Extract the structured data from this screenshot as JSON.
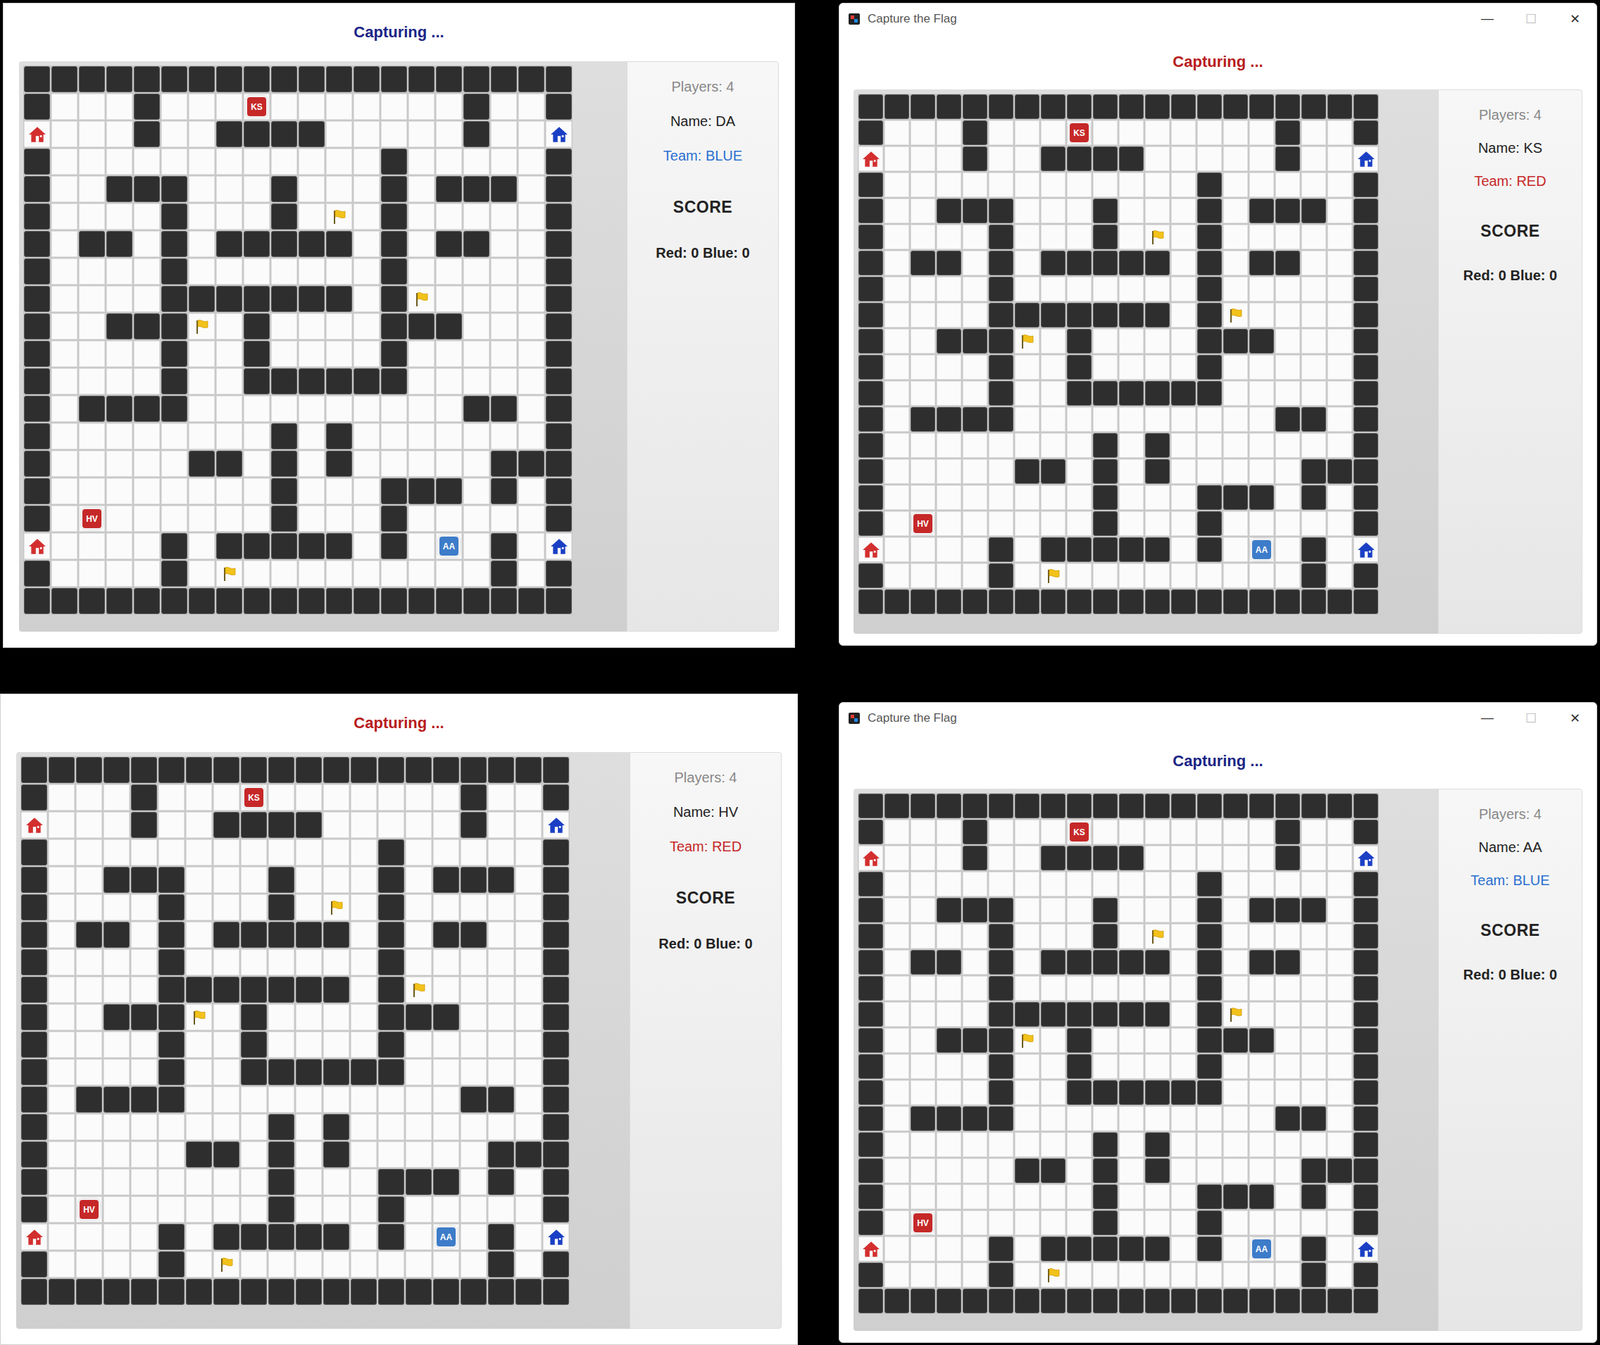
{
  "board": [
    "####################",
    "#...#...........#..#",
    "R...#..####.....#..B",
    "#............#.....#",
    "#..###...#...#.###.#",
    "#....#...#.F.#.....#",
    "#.##.#.#####.#.##..#",
    "#....#.......#.....#",
    "#....#######.#F....#",
    "#..###F.#....###...#",
    "#....#..#....#.....#",
    "#....#..######.....#",
    "#.####..........##.#",
    "#........#.#.......#",
    "#.....##.#.#.....###",
    "#........#...###.#.#",
    "#........#...#.....#",
    "R....#.#####.#...#.B",
    "#....#.F.........#.#",
    "####################"
  ],
  "home_colors": {
    "R": "#d32f2f",
    "B": "#1a3fc4"
  },
  "pieces": [
    {
      "label": "KS",
      "row": 1,
      "col": 8,
      "color": "#c62828"
    },
    {
      "label": "HV",
      "row": 16,
      "col": 2,
      "color": "#c62828"
    },
    {
      "label": "AA",
      "row": 17,
      "col": 15,
      "color": "#3d7cc9"
    }
  ],
  "windows": [
    {
      "title": "",
      "controls": [],
      "status": "Capturing ...",
      "status_color": "#1a2585",
      "players": "Players: 4",
      "name": "Name: DA",
      "team": "Team: BLUE",
      "team_color": "#2a6fd0",
      "score_heading": "SCORE",
      "score": "Red: 0 Blue: 0"
    },
    {
      "title": "Capture the Flag",
      "controls": [
        {
          "label": "—",
          "disabled": false
        },
        {
          "label": "☐",
          "disabled": true
        },
        {
          "label": "✕",
          "disabled": false
        }
      ],
      "status": "Capturing ...",
      "status_color": "#b71c1c",
      "players": "Players: 4",
      "name": "Name: KS",
      "team": "Team: RED",
      "team_color": "#c62828",
      "score_heading": "SCORE",
      "score": "Red: 0 Blue: 0"
    },
    {
      "title": "",
      "controls": [],
      "status": "Capturing ...",
      "status_color": "#b71c1c",
      "players": "Players: 4",
      "name": "Name: HV",
      "team": "Team: RED",
      "team_color": "#c62828",
      "score_heading": "SCORE",
      "score": "Red: 0 Blue: 0"
    },
    {
      "title": "Capture the Flag",
      "controls": [
        {
          "label": "—",
          "disabled": false
        },
        {
          "label": "☐",
          "disabled": true
        },
        {
          "label": "✕",
          "disabled": false
        }
      ],
      "status": "Capturing ...",
      "status_color": "#1a2585",
      "players": "Players: 4",
      "name": "Name: AA",
      "team": "Team: BLUE",
      "team_color": "#2a6fd0",
      "score_heading": "SCORE",
      "score": "Red: 0 Blue: 0"
    }
  ]
}
